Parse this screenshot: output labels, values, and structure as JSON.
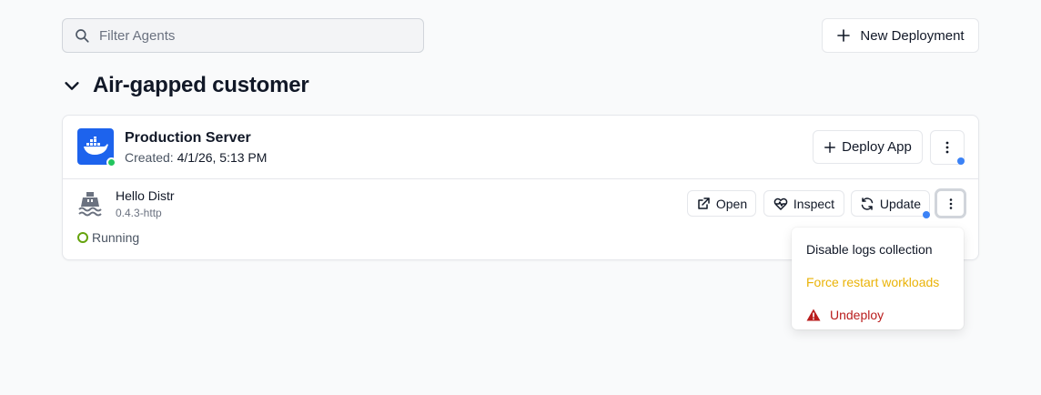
{
  "search": {
    "placeholder": "Filter Agents",
    "icon": "search-icon"
  },
  "toolbar": {
    "new_deployment_label": "New Deployment"
  },
  "group": {
    "title": "Air-gapped customer"
  },
  "server": {
    "name": "Production Server",
    "created_label": "Created:",
    "created_value": "4/1/26, 5:13 PM",
    "deploy_app_label": "Deploy App",
    "status_color": "#22c55e"
  },
  "app": {
    "name": "Hello Distr",
    "version": "0.4.3-http",
    "status": "Running",
    "actions": {
      "open": "Open",
      "inspect": "Inspect",
      "update": "Update"
    }
  },
  "menu": {
    "items": [
      {
        "label": "Disable logs collection"
      },
      {
        "label": "Force restart workloads"
      },
      {
        "label": "Undeploy"
      }
    ]
  },
  "colors": {
    "accent_blue": "#3b82f6",
    "docker_blue": "#1d63ed",
    "running_green": "#65a30d",
    "warning_yellow": "#eab308",
    "danger_red": "#b91c1c"
  }
}
